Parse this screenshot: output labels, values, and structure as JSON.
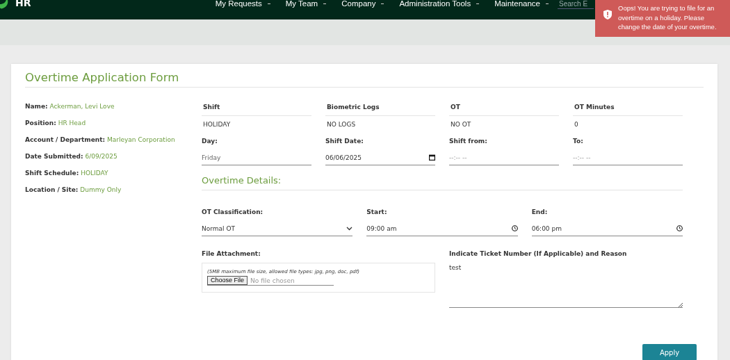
{
  "app": {
    "logo": "HR"
  },
  "nav": [
    {
      "label": "My Requests"
    },
    {
      "label": "My Team"
    },
    {
      "label": "Company"
    },
    {
      "label": "Administration Tools"
    },
    {
      "label": "Maintenance"
    }
  ],
  "search": {
    "placeholder": "Search E"
  },
  "toast": {
    "message": "Oops! You are trying to file for an overtime on a holiday. Please change the date of your overtime."
  },
  "form": {
    "title": "Overtime Application Form",
    "info": [
      {
        "label": "Name:",
        "value": "Ackerman, Levi Love"
      },
      {
        "label": "Position:",
        "value": "HR Head"
      },
      {
        "label": "Account / Department:",
        "value": "Marleyan Corporation"
      },
      {
        "label": "Date Submitted:",
        "value": "6/09/2025"
      },
      {
        "label": "Shift Schedule:",
        "value": "HOLIDAY"
      },
      {
        "label": "Location / Site:",
        "value": "Dummy Only"
      }
    ],
    "summary": {
      "columns": [
        "Shift",
        "Biometric Logs",
        "OT",
        "OT Minutes"
      ],
      "row": [
        "HOLIDAY",
        "NO LOGS",
        "NO OT",
        "0"
      ]
    },
    "shift_fields": [
      {
        "label": "Day:",
        "value": "Friday",
        "kind": "readonly"
      },
      {
        "label": "Shift Date:",
        "value": "06/06/2025",
        "kind": "date"
      },
      {
        "label": "Shift from:",
        "placeholder": "--:-- --",
        "kind": "empty"
      },
      {
        "label": "To:",
        "placeholder": "--:-- --",
        "kind": "empty"
      }
    ],
    "section_title": "Overtime Details:",
    "ot_fields": [
      {
        "label": "OT Classification:",
        "value": "Normal OT",
        "kind": "select"
      },
      {
        "label": "Start:",
        "value": "09:00 am",
        "kind": "time"
      },
      {
        "label": "End:",
        "value": "06:00 pm",
        "kind": "time"
      }
    ],
    "attachment": {
      "label": "File Attachment:",
      "note": "(5MB maximum file size, allowed file types: jpg, png, doc, pdf)",
      "button": "Choose File",
      "status": "No file chosen"
    },
    "reason": {
      "label": "Indicate Ticket Number (If Applicable) and Reason",
      "value": "test"
    },
    "apply": "Apply"
  }
}
